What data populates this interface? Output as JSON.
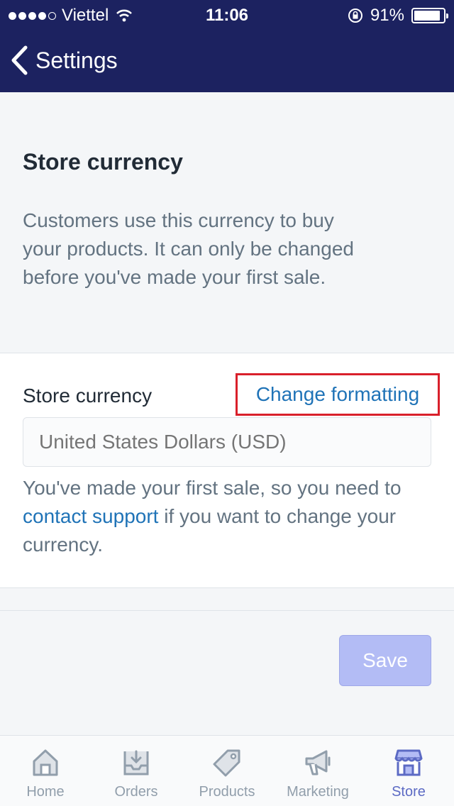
{
  "status_bar": {
    "carrier": "Viettel",
    "time": "11:06",
    "battery": "91%",
    "battery_level": 0.91
  },
  "nav": {
    "back_label": "Settings"
  },
  "intro": {
    "title": "Store currency",
    "description": "Customers use this currency to buy your products. It can only be changed before you've made your first sale."
  },
  "currency_card": {
    "label": "Store currency",
    "change_link": "Change formatting",
    "input_placeholder": "United States Dollars (USD)",
    "help_before": "You've made your first sale, so you need to ",
    "help_link": "contact support",
    "help_after": " if you want to change your currency."
  },
  "save_label": "Save",
  "tabs": [
    {
      "label": "Home",
      "icon": "home-icon",
      "active": false
    },
    {
      "label": "Orders",
      "icon": "orders-icon",
      "active": false
    },
    {
      "label": "Products",
      "icon": "tag-icon",
      "active": false
    },
    {
      "label": "Marketing",
      "icon": "megaphone-icon",
      "active": false
    },
    {
      "label": "Store",
      "icon": "store-icon",
      "active": true
    }
  ],
  "colors": {
    "nav_background": "#1c2260",
    "link": "#1f73b7",
    "highlight_border": "#d9202b",
    "save_disabled": "#b3bcf5",
    "tab_active": "#5c6ac4",
    "tab_inactive": "#919eab"
  }
}
